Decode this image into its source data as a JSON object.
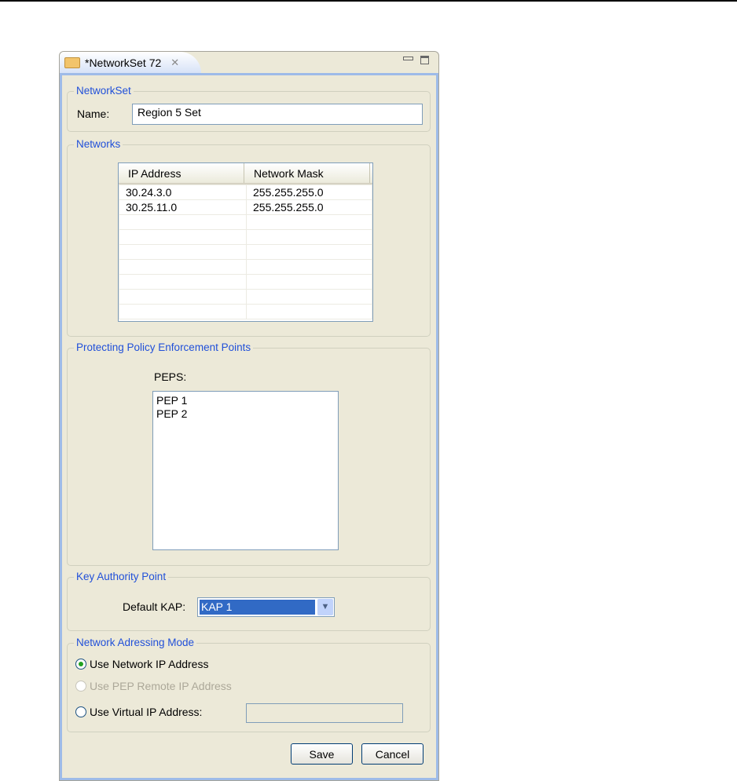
{
  "tab": {
    "title": "*NetworkSet 72",
    "icon": "folder-open-icon"
  },
  "networkset": {
    "legend": "NetworkSet",
    "name_label": "Name:",
    "name_value": "Region 5 Set"
  },
  "networks": {
    "legend": "Networks",
    "columns": [
      "IP Address",
      "Network Mask"
    ],
    "rows": [
      [
        "30.24.3.0",
        "255.255.255.0"
      ],
      [
        "30.25.11.0",
        "255.255.255.0"
      ],
      [
        "",
        ""
      ],
      [
        "",
        ""
      ],
      [
        "",
        ""
      ],
      [
        "",
        ""
      ],
      [
        "",
        ""
      ],
      [
        "",
        ""
      ],
      [
        "",
        ""
      ]
    ]
  },
  "peps": {
    "legend": "Protecting Policy Enforcement Points",
    "label": "PEPS:",
    "items": [
      "PEP 1",
      "PEP 2"
    ]
  },
  "kap": {
    "legend": "Key Authority Point",
    "label": "Default KAP:",
    "value": "KAP 1"
  },
  "mode": {
    "legend": "Network Adressing Mode",
    "options": [
      {
        "label": "Use Network IP Address",
        "checked": true,
        "enabled": true
      },
      {
        "label": "Use PEP Remote IP Address",
        "checked": false,
        "enabled": false
      },
      {
        "label": "Use Virtual IP Address:",
        "checked": false,
        "enabled": true
      }
    ],
    "virtual_ip_value": ""
  },
  "buttons": {
    "save": "Save",
    "cancel": "Cancel"
  }
}
